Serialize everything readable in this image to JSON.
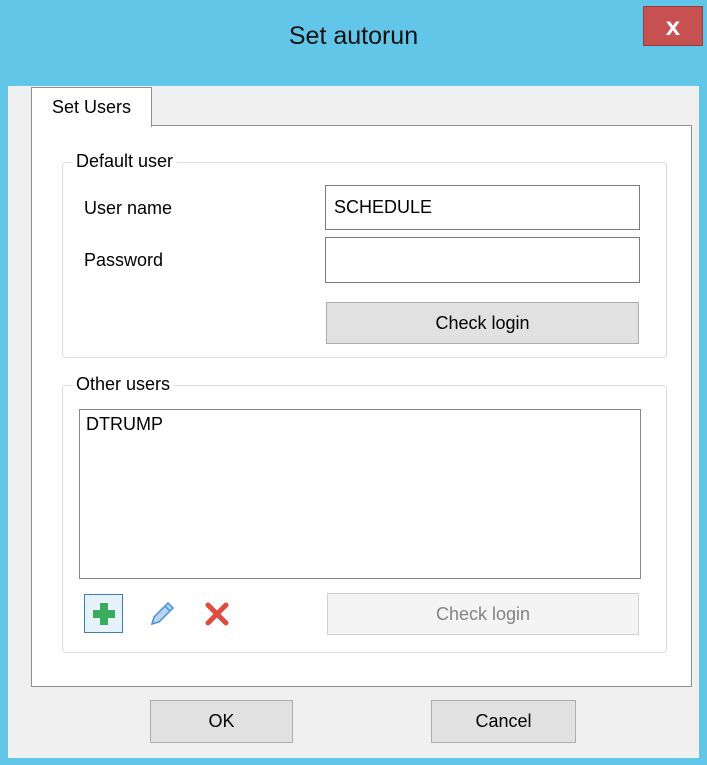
{
  "window": {
    "title": "Set autorun",
    "close_label": "x"
  },
  "tabs": [
    {
      "label": "Set Users"
    }
  ],
  "default_user": {
    "legend": "Default user",
    "username_label": "User name",
    "username_value": "SCHEDULE",
    "password_label": "Password",
    "password_value": "",
    "check_login_label": "Check login"
  },
  "other_users": {
    "legend": "Other users",
    "items": [
      "DTRUMP"
    ],
    "add_icon": "plus-icon",
    "edit_icon": "pencil-icon",
    "delete_icon": "x-icon",
    "check_login_label": "Check login",
    "check_login_enabled": false
  },
  "footer": {
    "ok_label": "OK",
    "cancel_label": "Cancel"
  },
  "colors": {
    "titlebar": "#62c6e8",
    "close": "#c75050",
    "plus": "#3aaa5c",
    "pencil": "#4a90d9",
    "delete": "#e04a3f"
  }
}
